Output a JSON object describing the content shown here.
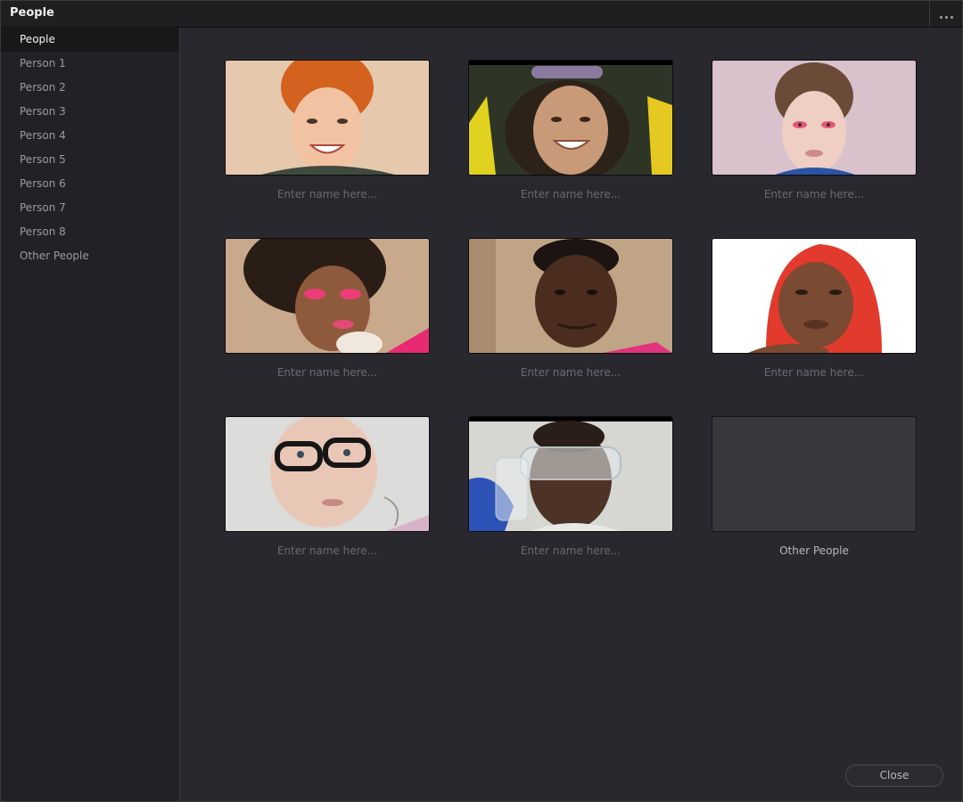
{
  "window": {
    "title": "People",
    "menu_icon": "more-horizontal-icon"
  },
  "sidebar": {
    "items": [
      {
        "label": "People",
        "selected": true
      },
      {
        "label": "Person 1"
      },
      {
        "label": "Person 2"
      },
      {
        "label": "Person 3"
      },
      {
        "label": "Person 4"
      },
      {
        "label": "Person 5"
      },
      {
        "label": "Person 6"
      },
      {
        "label": "Person 7"
      },
      {
        "label": "Person 8"
      },
      {
        "label": "Other People"
      }
    ]
  },
  "grid": {
    "cards": [
      {
        "placeholder": "Enter name here...",
        "value": ""
      },
      {
        "placeholder": "Enter name here...",
        "value": ""
      },
      {
        "placeholder": "Enter name here...",
        "value": ""
      },
      {
        "placeholder": "Enter name here...",
        "value": ""
      },
      {
        "placeholder": "Enter name here...",
        "value": ""
      },
      {
        "placeholder": "Enter name here...",
        "value": ""
      },
      {
        "placeholder": "Enter name here...",
        "value": ""
      },
      {
        "placeholder": "Enter name here...",
        "value": ""
      },
      {
        "label": "Other People"
      }
    ]
  },
  "footer": {
    "close_label": "Close"
  }
}
